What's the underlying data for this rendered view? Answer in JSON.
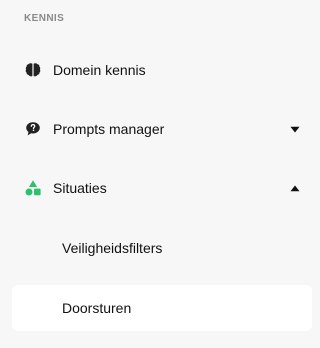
{
  "section": {
    "title": "KENNIS"
  },
  "nav": {
    "items": [
      {
        "label": "Domein kennis",
        "icon": "brain-icon"
      },
      {
        "label": "Prompts manager",
        "icon": "speech-bubble-question-icon",
        "chevron": "chevron-down-icon"
      },
      {
        "label": "Situaties",
        "icon": "shapes-icon",
        "chevron": "chevron-up-icon",
        "expanded": true
      }
    ],
    "subitems": [
      {
        "label": "Veiligheidsfilters"
      },
      {
        "label": "Doorsturen",
        "active": true
      }
    ]
  },
  "colors": {
    "background": "#f7f7f7",
    "active_bg": "#ffffff",
    "accent_green": "#2fbf71",
    "section_title": "#8a8a8a"
  }
}
